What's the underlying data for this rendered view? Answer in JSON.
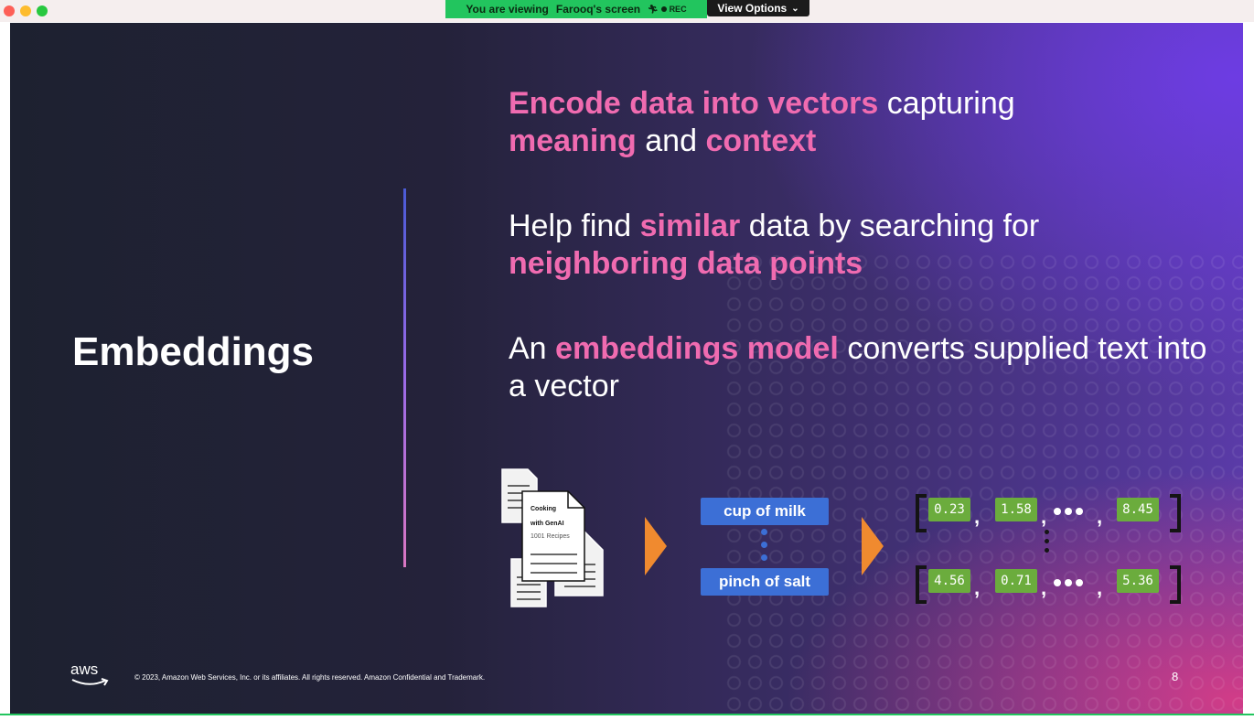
{
  "share_banner": {
    "viewing_label": "You are viewing",
    "presenter": "Farooq's screen",
    "rec_label": "REC"
  },
  "view_options_label": "View Options",
  "slide": {
    "heading": "Embeddings",
    "points": [
      {
        "segments": [
          {
            "text": "Encode data into vectors",
            "highlight": true
          },
          {
            "text": " capturing ",
            "highlight": false
          },
          {
            "text": "meaning",
            "highlight": true
          },
          {
            "text": " and ",
            "highlight": false
          },
          {
            "text": "context",
            "highlight": true
          }
        ]
      },
      {
        "segments": [
          {
            "text": "Help find ",
            "highlight": false
          },
          {
            "text": "similar",
            "highlight": true
          },
          {
            "text": " data by searching for ",
            "highlight": false
          },
          {
            "text": "neighboring data points",
            "highlight": true
          }
        ]
      },
      {
        "segments": [
          {
            "text": "An ",
            "highlight": false
          },
          {
            "text": "embeddings model",
            "highlight": true
          },
          {
            "text": " converts supplied text into a vector",
            "highlight": false
          }
        ]
      }
    ],
    "document": {
      "line1": "Cooking",
      "line2": "with GenAI",
      "line3": "1001 Recipes"
    },
    "phrases": [
      "cup of milk",
      "pinch of salt"
    ],
    "vectors": [
      [
        "0.23",
        "1.58",
        "8.45"
      ],
      [
        "4.56",
        "0.71",
        "5.36"
      ]
    ],
    "footer": {
      "logo_text": "aws",
      "copyright": "© 2023, Amazon Web Services, Inc. or its affiliates. All rights reserved. Amazon Confidential and Trademark.",
      "page_number": "8"
    }
  },
  "colors": {
    "highlight": "#f06bb0",
    "phrase_pill": "#3c6fd6",
    "vector_value": "#6bac3d",
    "arrow": "#f08a2f",
    "share_banner": "#22c55e"
  }
}
